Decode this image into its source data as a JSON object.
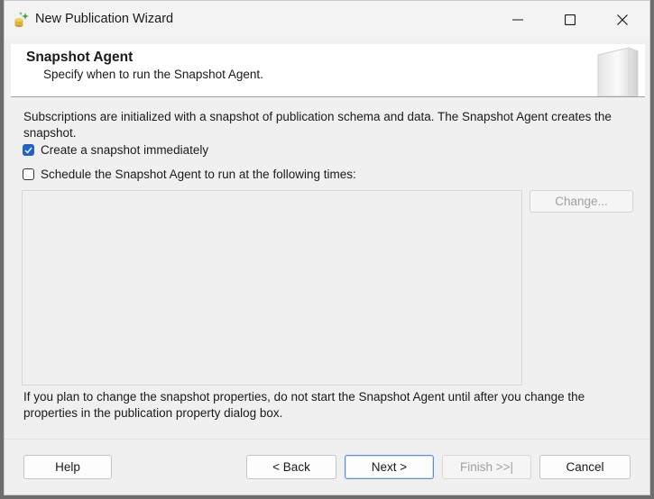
{
  "window": {
    "title": "New Publication Wizard"
  },
  "header": {
    "title": "Snapshot Agent",
    "subtitle": "Specify when to run the Snapshot Agent."
  },
  "content": {
    "description": "Subscriptions are initialized with a snapshot of publication schema and data. The Snapshot Agent creates the snapshot.",
    "create_snapshot_label": "Create a snapshot immediately",
    "create_snapshot_checked": true,
    "schedule_label": "Schedule the Snapshot Agent to run at the following times:",
    "schedule_checked": false,
    "change_label": "Change...",
    "note": "If you plan to change the snapshot properties, do not start the Snapshot Agent until after you change the properties in the publication property dialog box."
  },
  "buttons": {
    "help": "Help",
    "back": "< Back",
    "next": "Next >",
    "finish": "Finish >>|",
    "cancel": "Cancel"
  },
  "icons": {
    "app": "publication-wizard-icon",
    "minimize": "minimize-icon",
    "maximize": "maximize-icon",
    "close": "close-icon",
    "check": "checkmark-icon"
  },
  "colors": {
    "accent": "#1f63c9",
    "window_bg": "#f0f0f0",
    "header_bg": "#ffffff"
  }
}
